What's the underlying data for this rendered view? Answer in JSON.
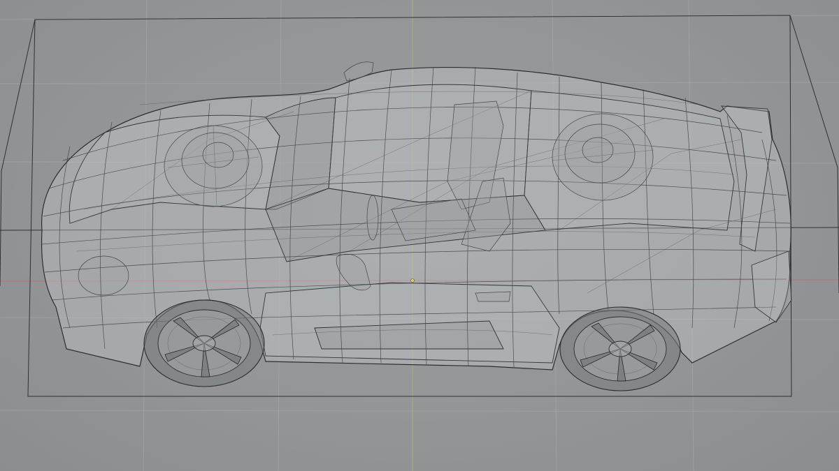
{
  "viewport": {
    "background_color": "#939597",
    "grid_color": "#a4a6a8",
    "x_axis_color": "#b3717a",
    "y_axis_color": "#a7b27a",
    "wire_color": "#3a3c40"
  },
  "objects": [
    {
      "kind": "car-wireframe-mesh",
      "display": "wireframe-xray",
      "bounding_box_visible": true
    }
  ]
}
